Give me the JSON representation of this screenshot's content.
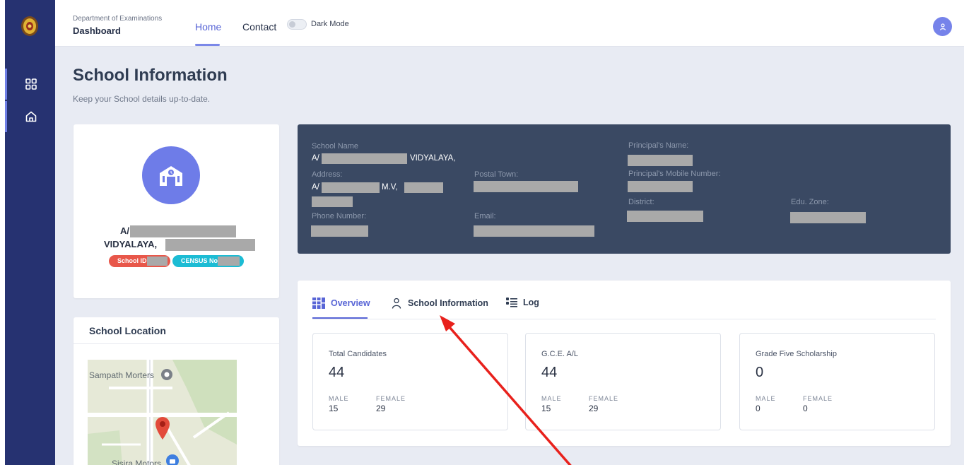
{
  "header": {
    "dept": "Department of Examinations",
    "title": "Dashboard",
    "nav_home": "Home",
    "nav_contact": "Contact",
    "dark_mode_label": "Dark Mode"
  },
  "page": {
    "title": "School Information",
    "subtitle": "Keep your School details up-to-date."
  },
  "profile": {
    "name_prefix": "A/",
    "name_line2": "VIDYALAYA,",
    "school_id_label": "School ID:",
    "census_label": "CENSUS No:"
  },
  "location": {
    "title": "School Location",
    "map_labels": [
      "Sampath Morters",
      "Sisira Motors"
    ]
  },
  "info": {
    "school_name_label": "School Name",
    "school_name_prefix": "A/",
    "school_name_suffix": "VIDYALAYA,",
    "address_label": "Address:",
    "address_prefix": "A/",
    "address_mid": "M.V,",
    "postal_town_label": "Postal Town:",
    "phone_label": "Phone Number:",
    "email_label": "Email:",
    "principal_name_label": "Principal's Name:",
    "principal_mobile_label": "Principal's Mobile Number:",
    "district_label": "District:",
    "zone_label": "Edu. Zone:"
  },
  "tabs": [
    {
      "label": "Overview",
      "active": true
    },
    {
      "label": "School Information",
      "active": false
    },
    {
      "label": "Log",
      "active": false
    }
  ],
  "stats": [
    {
      "title": "Total Candidates",
      "total": "44",
      "male_label": "MALE",
      "female_label": "FEMALE",
      "male": "15",
      "female": "29"
    },
    {
      "title": "G.C.E. A/L",
      "total": "44",
      "male_label": "MALE",
      "female_label": "FEMALE",
      "male": "15",
      "female": "29"
    },
    {
      "title": "Grade Five Scholarship",
      "total": "0",
      "male_label": "MALE",
      "female_label": "FEMALE",
      "male": "0",
      "female": "0"
    }
  ],
  "colors": {
    "sidebar": "#263271",
    "accent": "#5865d6",
    "info_panel": "#3a4963",
    "badge_red": "#e8574a",
    "badge_cyan": "#1cbcd4",
    "annotation_arrow": "#e8211c"
  }
}
